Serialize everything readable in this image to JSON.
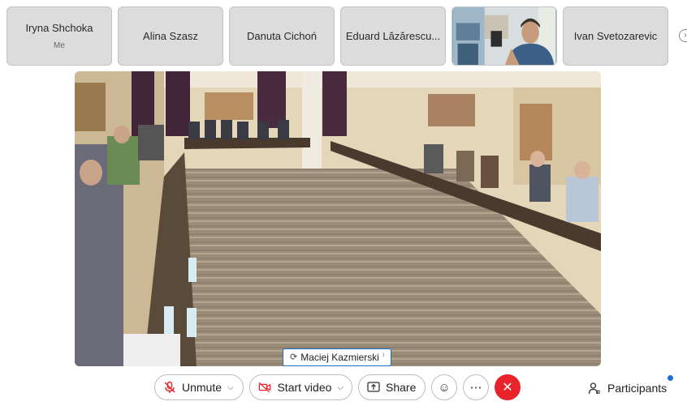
{
  "participants_strip": {
    "tiles": [
      {
        "name": "Iryna Shchoka",
        "sub": "Me"
      },
      {
        "name": "Alina Szasz"
      },
      {
        "name": "Danuta Cichoń"
      },
      {
        "name": "Eduard Lăzărescu..."
      },
      {
        "name": ""
      },
      {
        "name": "Ivan Svetozarevic"
      }
    ],
    "more_icon": "chevron-right-icon"
  },
  "main_video": {
    "speaker_label": "Maciej Kazmierski",
    "speaker_icon": "sync-icon",
    "signal_icon": "audio-signal-icon"
  },
  "controls": {
    "unmute_label": "Unmute",
    "start_video_label": "Start video",
    "share_label": "Share",
    "participants_label": "Participants",
    "end_color": "#e8232b",
    "accent_color": "#1f6fd1"
  }
}
